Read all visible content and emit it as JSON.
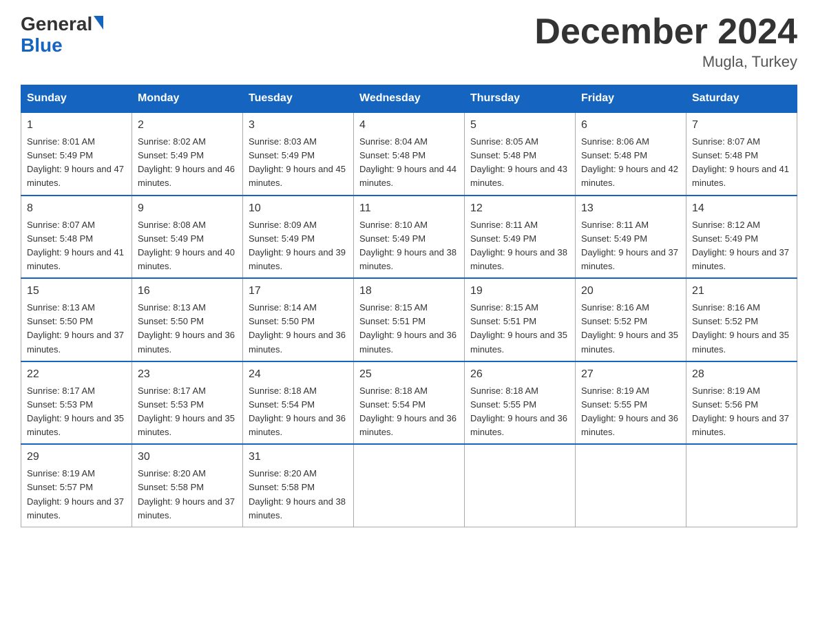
{
  "header": {
    "logo_general": "General",
    "logo_blue": "Blue",
    "month_title": "December 2024",
    "location": "Mugla, Turkey"
  },
  "days_of_week": [
    "Sunday",
    "Monday",
    "Tuesday",
    "Wednesday",
    "Thursday",
    "Friday",
    "Saturday"
  ],
  "weeks": [
    [
      {
        "day": "1",
        "sunrise": "8:01 AM",
        "sunset": "5:49 PM",
        "daylight": "9 hours and 47 minutes."
      },
      {
        "day": "2",
        "sunrise": "8:02 AM",
        "sunset": "5:49 PM",
        "daylight": "9 hours and 46 minutes."
      },
      {
        "day": "3",
        "sunrise": "8:03 AM",
        "sunset": "5:49 PM",
        "daylight": "9 hours and 45 minutes."
      },
      {
        "day": "4",
        "sunrise": "8:04 AM",
        "sunset": "5:48 PM",
        "daylight": "9 hours and 44 minutes."
      },
      {
        "day": "5",
        "sunrise": "8:05 AM",
        "sunset": "5:48 PM",
        "daylight": "9 hours and 43 minutes."
      },
      {
        "day": "6",
        "sunrise": "8:06 AM",
        "sunset": "5:48 PM",
        "daylight": "9 hours and 42 minutes."
      },
      {
        "day": "7",
        "sunrise": "8:07 AM",
        "sunset": "5:48 PM",
        "daylight": "9 hours and 41 minutes."
      }
    ],
    [
      {
        "day": "8",
        "sunrise": "8:07 AM",
        "sunset": "5:48 PM",
        "daylight": "9 hours and 41 minutes."
      },
      {
        "day": "9",
        "sunrise": "8:08 AM",
        "sunset": "5:49 PM",
        "daylight": "9 hours and 40 minutes."
      },
      {
        "day": "10",
        "sunrise": "8:09 AM",
        "sunset": "5:49 PM",
        "daylight": "9 hours and 39 minutes."
      },
      {
        "day": "11",
        "sunrise": "8:10 AM",
        "sunset": "5:49 PM",
        "daylight": "9 hours and 38 minutes."
      },
      {
        "day": "12",
        "sunrise": "8:11 AM",
        "sunset": "5:49 PM",
        "daylight": "9 hours and 38 minutes."
      },
      {
        "day": "13",
        "sunrise": "8:11 AM",
        "sunset": "5:49 PM",
        "daylight": "9 hours and 37 minutes."
      },
      {
        "day": "14",
        "sunrise": "8:12 AM",
        "sunset": "5:49 PM",
        "daylight": "9 hours and 37 minutes."
      }
    ],
    [
      {
        "day": "15",
        "sunrise": "8:13 AM",
        "sunset": "5:50 PM",
        "daylight": "9 hours and 37 minutes."
      },
      {
        "day": "16",
        "sunrise": "8:13 AM",
        "sunset": "5:50 PM",
        "daylight": "9 hours and 36 minutes."
      },
      {
        "day": "17",
        "sunrise": "8:14 AM",
        "sunset": "5:50 PM",
        "daylight": "9 hours and 36 minutes."
      },
      {
        "day": "18",
        "sunrise": "8:15 AM",
        "sunset": "5:51 PM",
        "daylight": "9 hours and 36 minutes."
      },
      {
        "day": "19",
        "sunrise": "8:15 AM",
        "sunset": "5:51 PM",
        "daylight": "9 hours and 35 minutes."
      },
      {
        "day": "20",
        "sunrise": "8:16 AM",
        "sunset": "5:52 PM",
        "daylight": "9 hours and 35 minutes."
      },
      {
        "day": "21",
        "sunrise": "8:16 AM",
        "sunset": "5:52 PM",
        "daylight": "9 hours and 35 minutes."
      }
    ],
    [
      {
        "day": "22",
        "sunrise": "8:17 AM",
        "sunset": "5:53 PM",
        "daylight": "9 hours and 35 minutes."
      },
      {
        "day": "23",
        "sunrise": "8:17 AM",
        "sunset": "5:53 PM",
        "daylight": "9 hours and 35 minutes."
      },
      {
        "day": "24",
        "sunrise": "8:18 AM",
        "sunset": "5:54 PM",
        "daylight": "9 hours and 36 minutes."
      },
      {
        "day": "25",
        "sunrise": "8:18 AM",
        "sunset": "5:54 PM",
        "daylight": "9 hours and 36 minutes."
      },
      {
        "day": "26",
        "sunrise": "8:18 AM",
        "sunset": "5:55 PM",
        "daylight": "9 hours and 36 minutes."
      },
      {
        "day": "27",
        "sunrise": "8:19 AM",
        "sunset": "5:55 PM",
        "daylight": "9 hours and 36 minutes."
      },
      {
        "day": "28",
        "sunrise": "8:19 AM",
        "sunset": "5:56 PM",
        "daylight": "9 hours and 37 minutes."
      }
    ],
    [
      {
        "day": "29",
        "sunrise": "8:19 AM",
        "sunset": "5:57 PM",
        "daylight": "9 hours and 37 minutes."
      },
      {
        "day": "30",
        "sunrise": "8:20 AM",
        "sunset": "5:58 PM",
        "daylight": "9 hours and 37 minutes."
      },
      {
        "day": "31",
        "sunrise": "8:20 AM",
        "sunset": "5:58 PM",
        "daylight": "9 hours and 38 minutes."
      },
      null,
      null,
      null,
      null
    ]
  ]
}
